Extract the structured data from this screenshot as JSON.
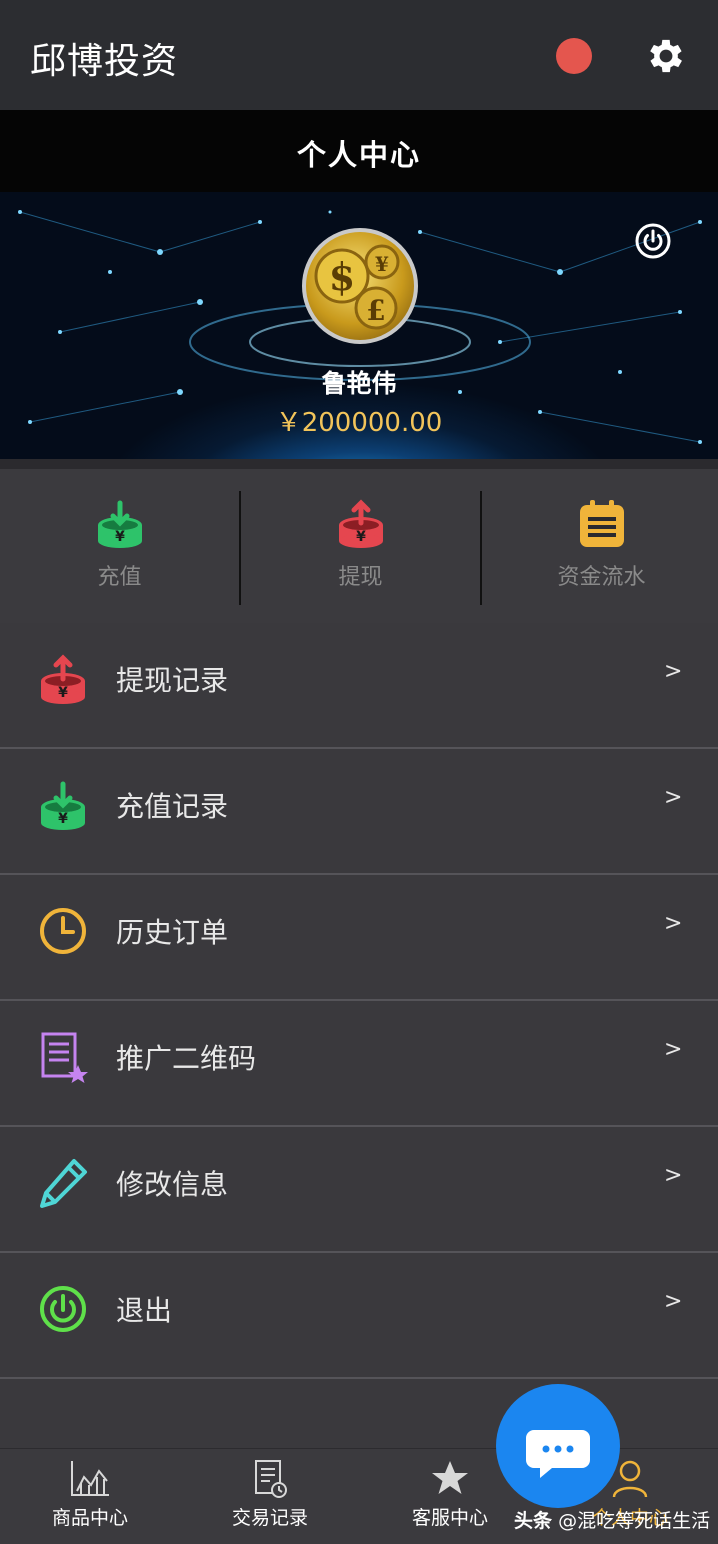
{
  "app": {
    "title": "邱博投资"
  },
  "page": {
    "title": "个人中心"
  },
  "user": {
    "name": "鲁艳伟",
    "balance": "￥200000.00"
  },
  "actions": [
    {
      "label": "充值",
      "icon": "deposit-icon",
      "color": "#2ec36a"
    },
    {
      "label": "提现",
      "icon": "withdraw-icon",
      "color": "#e5464f"
    },
    {
      "label": "资金流水",
      "icon": "ledger-icon",
      "color": "#f0b43a"
    }
  ],
  "menu": [
    {
      "label": "提现记录",
      "icon": "withdraw-record-icon",
      "chevron": ">"
    },
    {
      "label": "充值记录",
      "icon": "deposit-record-icon",
      "chevron": ">"
    },
    {
      "label": "历史订单",
      "icon": "clock-icon",
      "chevron": ">"
    },
    {
      "label": "推广二维码",
      "icon": "document-star-icon",
      "chevron": ">"
    },
    {
      "label": "修改信息",
      "icon": "pencil-icon",
      "chevron": ">"
    },
    {
      "label": "退出",
      "icon": "power-icon",
      "chevron": ">"
    }
  ],
  "bottom_nav": [
    {
      "label": "商品中心",
      "icon": "chart-icon"
    },
    {
      "label": "交易记录",
      "icon": "record-icon"
    },
    {
      "label": "客服中心",
      "icon": "star-icon"
    },
    {
      "label": "个人中心",
      "icon": "user-icon"
    }
  ],
  "watermark": {
    "brand": "头条",
    "handle": "@混吃等死话生活"
  },
  "colors": {
    "accent_blue": "#1b86f0",
    "gold": "#f2c45a",
    "status_red": "#e4564e"
  }
}
